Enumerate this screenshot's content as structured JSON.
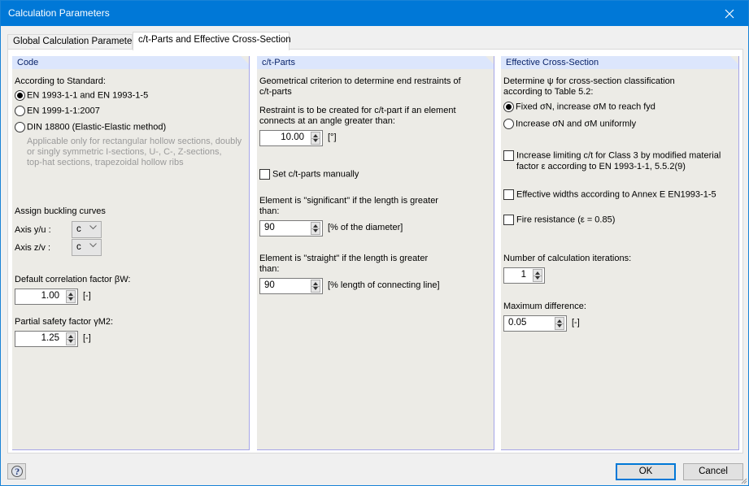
{
  "window": {
    "title": "Calculation Parameters",
    "close_icon": "close-icon"
  },
  "tabs": [
    {
      "label": "Global Calculation Parameters",
      "active": false
    },
    {
      "label": "c/t-Parts and Effective Cross-Section",
      "active": true
    }
  ],
  "code_panel": {
    "header": "Code",
    "standard_label": "According to Standard:",
    "standards": [
      {
        "label": "EN 1993-1-1 and EN 1993-1-5",
        "selected": true
      },
      {
        "label": "EN 1999-1-1:2007",
        "selected": false
      },
      {
        "label": "DIN 18800 (Elastic-Elastic method)",
        "selected": false
      }
    ],
    "din_note": [
      "Applicable only for rectangular hollow sections, doubly",
      "or singly symmetric I-sections, U-, C-, Z-sections,",
      "top-hat sections, trapezoidal hollow ribs"
    ],
    "buckling_label": "Assign buckling curves",
    "axis_yu_label": "Axis y/u :",
    "axis_yu_value": "c",
    "axis_zv_label": "Axis z/v :",
    "axis_zv_value": "c",
    "corr_factor_label": "Default correlation factor βW:",
    "corr_factor_value": "1.00",
    "corr_factor_unit": "[-]",
    "safety_factor_label": "Partial safety factor γM2:",
    "safety_factor_value": "1.25",
    "safety_factor_unit": "[-]"
  },
  "ct_panel": {
    "header": "c/t-Parts",
    "geom_text": [
      "Geometrical criterion to determine end restraints of",
      "c/t-parts"
    ],
    "restraint_text": [
      "Restraint is to be created for c/t-part if an element",
      "connects at an angle greater than:"
    ],
    "angle_value": "10.00",
    "angle_unit": "[°]",
    "manual_label": "Set c/t-parts manually",
    "manual_checked": false,
    "significant_text": [
      "Element is \"significant\" if the length is greater",
      "than:"
    ],
    "significant_value": "90",
    "significant_unit": "[% of the diameter]",
    "straight_text": [
      "Element is \"straight\" if the length is greater",
      "than:"
    ],
    "straight_value": "90",
    "straight_unit": "[% length of connecting line]"
  },
  "ecs_panel": {
    "header": "Effective Cross-Section",
    "psi_text": [
      "Determine ψ for cross-section classification",
      "according to Table 5.2:"
    ],
    "psi_options": [
      {
        "label": "Fixed σN, increase σM to reach fyd",
        "selected": true
      },
      {
        "label": "Increase σN and σM uniformly",
        "selected": false
      }
    ],
    "increase_limit_text": [
      "Increase limiting c/t for Class 3 by modified material",
      "factor ε according to EN 1993-1-1, 5.5.2(9)"
    ],
    "increase_limit_checked": false,
    "eff_widths_label": "Effective widths according to Annex E EN1993-1-5",
    "eff_widths_checked": false,
    "fire_label": "Fire resistance (ε = 0.85)",
    "fire_checked": false,
    "iterations_label": "Number of calculation iterations:",
    "iterations_value": "1",
    "max_diff_label": "Maximum difference:",
    "max_diff_value": "0.05",
    "max_diff_unit": "[-]"
  },
  "footer": {
    "help_icon": "help-icon",
    "ok_label": "OK",
    "cancel_label": "Cancel"
  }
}
